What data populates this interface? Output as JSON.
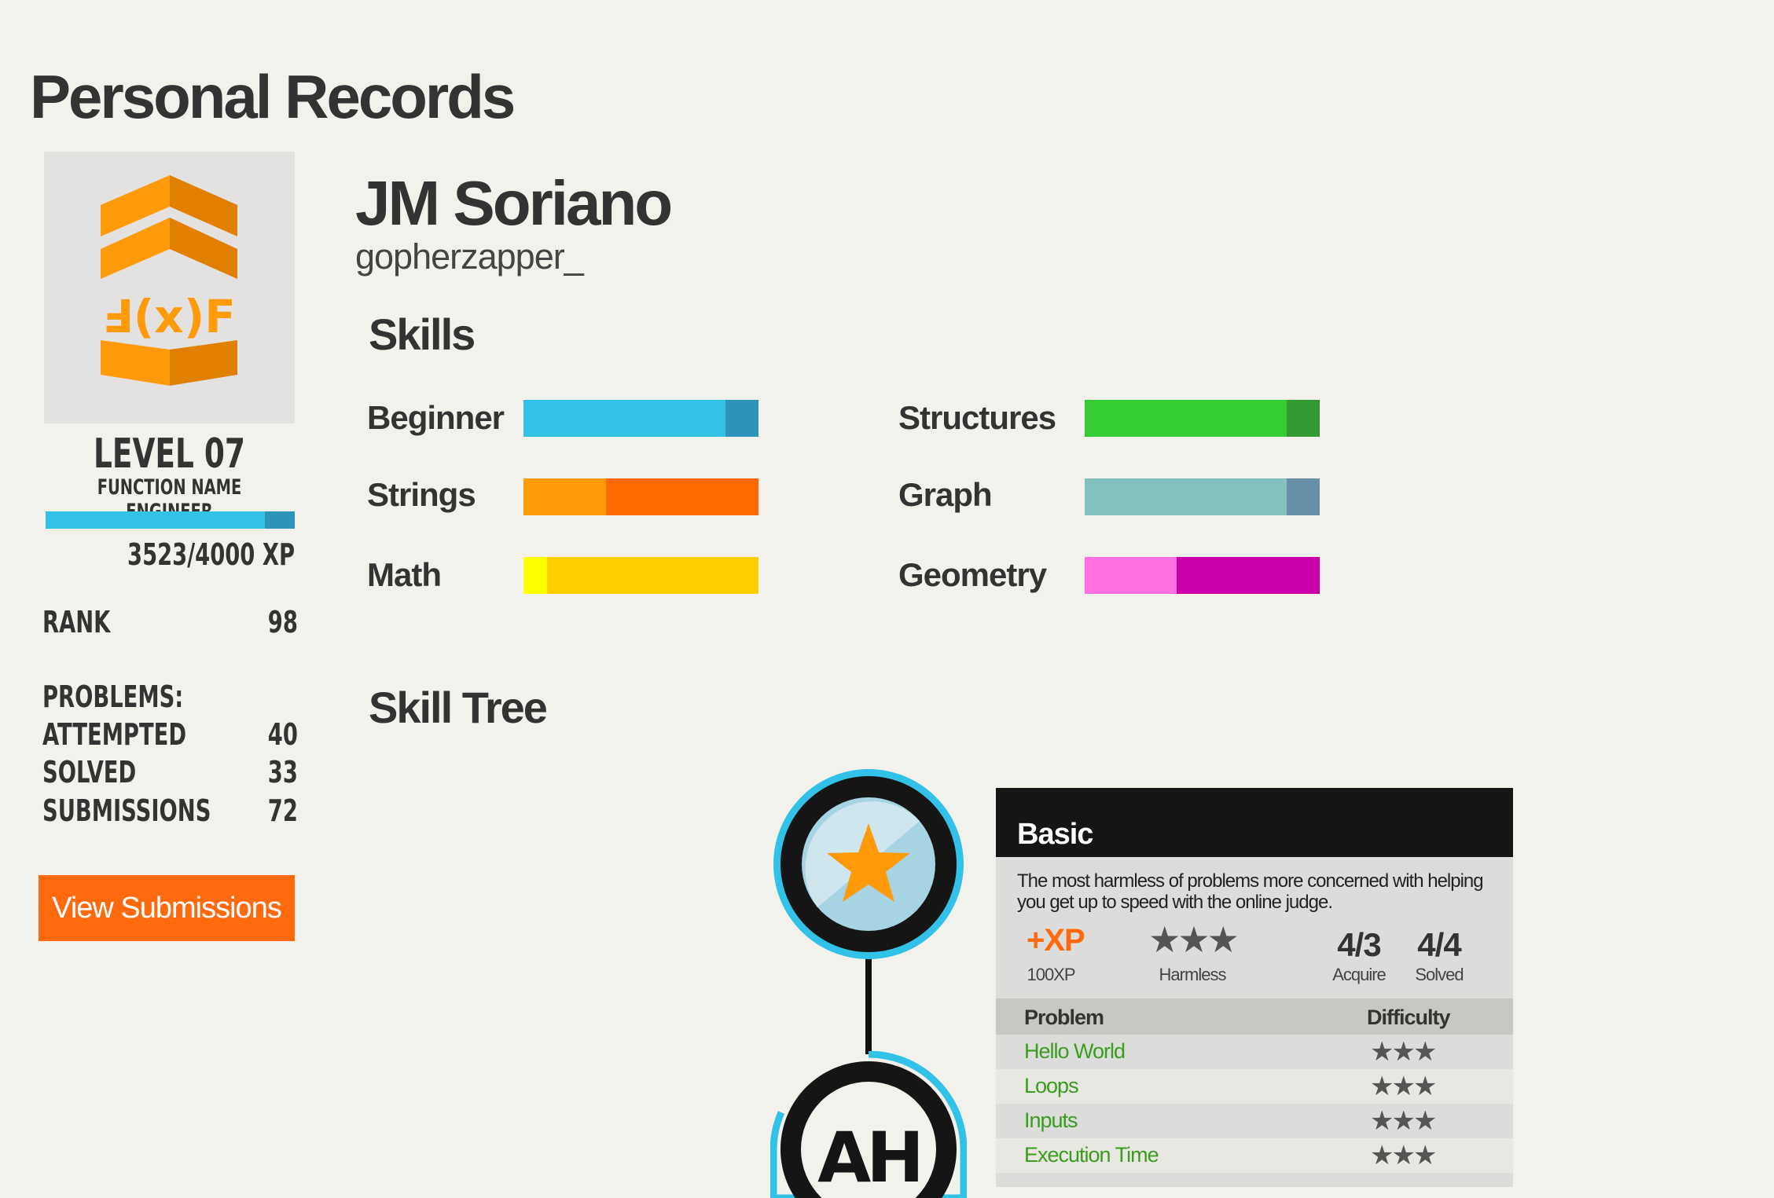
{
  "page": {
    "title": "Personal Records"
  },
  "profile": {
    "level": "LEVEL 07",
    "level_title": "FUNCTION NAME ENGINEER",
    "xp_text": "3523/4000 XP",
    "xp_progress": 0.8808,
    "rank_label": "RANK",
    "rank_value": "98",
    "problems_label": "PROBLEMS:",
    "attempted_label": "ATTEMPTED",
    "attempted_value": "40",
    "solved_label": "SOLVED",
    "solved_value": "33",
    "submissions_label": "SUBMISSIONS",
    "submissions_value": "72",
    "view_button": "View Submissions",
    "badge_icon": "chevron-rank-badge-icon"
  },
  "user": {
    "name": "JM Soriano",
    "handle": "gopherzapper_"
  },
  "skills": {
    "title": "Skills",
    "items": [
      {
        "label": "Beginner",
        "value": 0.86,
        "fill": "#32c2e8",
        "rest": "#2b94b8"
      },
      {
        "label": "Strings",
        "value": 0.35,
        "fill": "#ff9a0a",
        "rest": "#ff6a00"
      },
      {
        "label": "Math",
        "value": 0.1,
        "fill": "#ffff00",
        "rest": "#ffcf00"
      },
      {
        "label": "Structures",
        "value": 0.86,
        "fill": "#33cc33",
        "rest": "#339933"
      },
      {
        "label": "Graph",
        "value": 0.86,
        "fill": "#83c1bf",
        "rest": "#6690a6"
      },
      {
        "label": "Geometry",
        "value": 0.39,
        "fill": "#ff70e0",
        "rest": "#cc00a8"
      }
    ]
  },
  "skill_tree": {
    "title": "Skill Tree",
    "node1_icon": "star-icon",
    "node2_label": "AH"
  },
  "card": {
    "title": "Basic",
    "description": "The most harmless of problems more concerned with helping you get up to speed with the online judge.",
    "xp_icon_text": "+XP",
    "xp_value": "100XP",
    "difficulty_stars": "★★★",
    "difficulty_label": "Harmless",
    "acquire_value": "4/3",
    "acquire_label": "Acquire",
    "solved_value": "4/4",
    "solved_label": "Solved",
    "col_problem": "Problem",
    "col_difficulty": "Difficulty",
    "problems": [
      {
        "name": "Hello World",
        "stars": "★★★"
      },
      {
        "name": "Loops",
        "stars": "★★★"
      },
      {
        "name": "Inputs",
        "stars": "★★★"
      },
      {
        "name": "Execution Time",
        "stars": "★★★"
      }
    ]
  }
}
